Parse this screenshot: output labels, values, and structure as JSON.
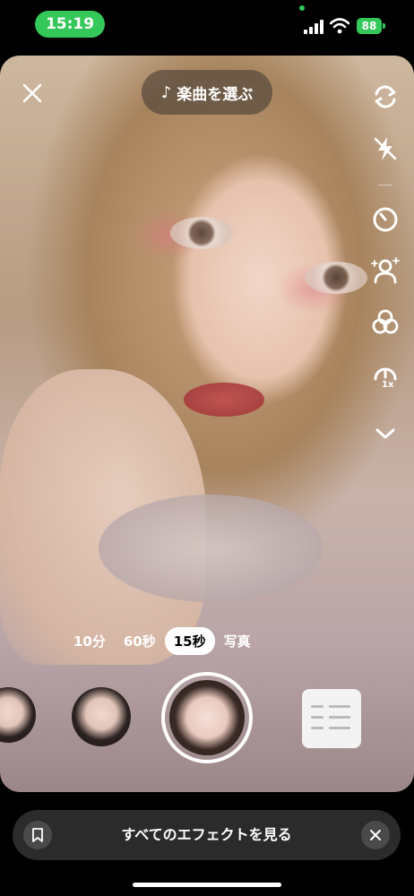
{
  "status_bar": {
    "time": "15:19",
    "battery": "88",
    "accent_color": "#34c759"
  },
  "camera": {
    "music_label": "楽曲を選ぶ",
    "icons": {
      "close": "close-icon",
      "music": "music-note-icon",
      "flip": "flip-camera-icon",
      "flash": "flash-off-icon",
      "timer": "timer-icon",
      "beauty": "beauty-icon",
      "filters": "filters-icon",
      "speed": "speed-icon",
      "more": "chevron-down-icon"
    },
    "speed_label": "1x",
    "durations": [
      {
        "label": "10分",
        "active": false
      },
      {
        "label": "60秒",
        "active": false
      },
      {
        "label": "15秒",
        "active": true
      },
      {
        "label": "写真",
        "active": false
      }
    ]
  },
  "effect_bar": {
    "label": "すべてのエフェクトを見る",
    "bookmark_icon": "bookmark-icon",
    "close_icon": "close-icon"
  }
}
